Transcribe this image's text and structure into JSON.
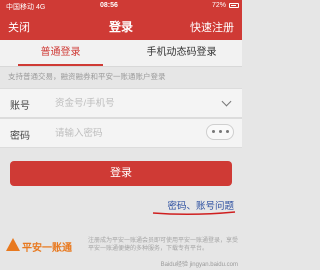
{
  "status_bar": {
    "carrier": "中国移动 4G",
    "time": "08:56",
    "battery": "72%"
  },
  "nav": {
    "close": "关闭",
    "title": "登录",
    "register": "快速注册"
  },
  "tabs": [
    {
      "label": "普通登录",
      "active": true
    },
    {
      "label": "手机动态码登录",
      "active": false
    }
  ],
  "notice": "支持普通交易，融资融券和平安一账通账户登录",
  "form": {
    "account_label": "账号",
    "account_placeholder": "资金号/手机号",
    "password_label": "密码",
    "password_placeholder": "请输入密码"
  },
  "login_button": "登录",
  "forgot_link": "密码、账号问题",
  "footer": {
    "logo_text": "平安一账通",
    "text": "注册成为平安一账通会员即可使用平安一账通登录，享受平安一账通便捷的多种服务，下载专有平台。"
  },
  "watermark": "Baidu经验 jingyan.baidu.com",
  "colors": {
    "brand_red": "#cf3a35",
    "link_blue": "#2c4fa0",
    "logo_orange": "#e8791f"
  }
}
